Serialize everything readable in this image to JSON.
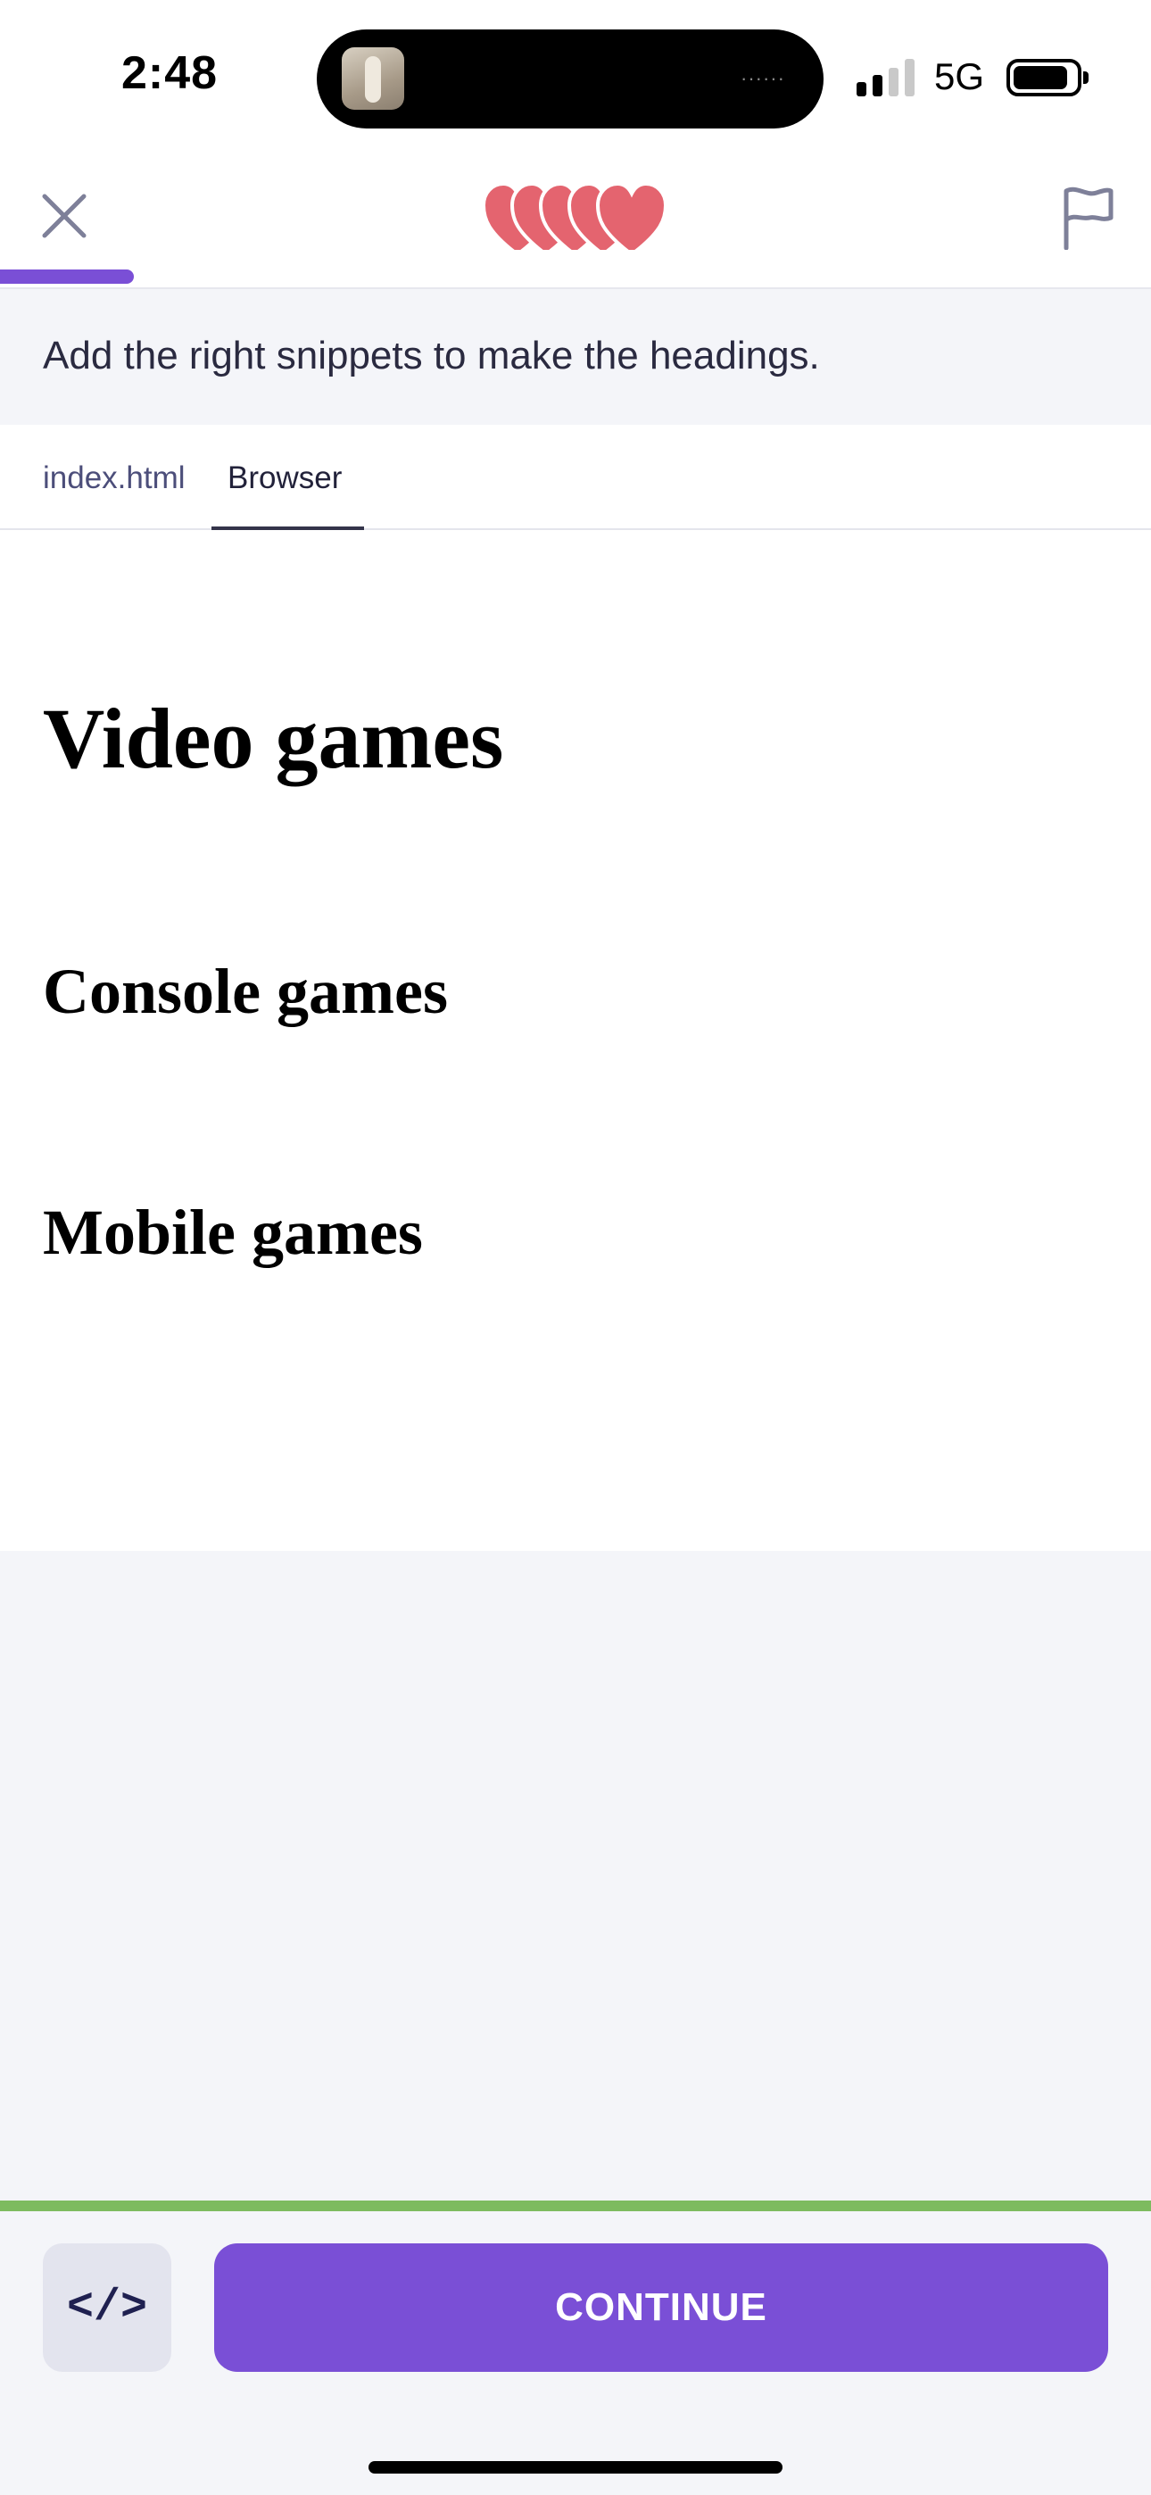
{
  "status_bar": {
    "time": "2:48",
    "network": "5G",
    "signal_bars_filled": 2,
    "signal_bars_total": 4,
    "island_dots": "······"
  },
  "header": {
    "close_icon": "close-icon",
    "hearts_count": 5,
    "heart_color": "#e4646f",
    "flag_icon": "flag-icon",
    "progress_fraction": 0.116,
    "progress_color": "#7a4fd6"
  },
  "instruction": {
    "text": "Add the right snippets to make the headings."
  },
  "tabs": [
    {
      "label": "index.html",
      "active": false
    },
    {
      "label": "Browser",
      "active": true
    }
  ],
  "browser": {
    "h1": "Video games",
    "h2_items": [
      "Console games",
      "Mobile games"
    ]
  },
  "bottom": {
    "code_label": "</>",
    "continue_label": "CONTINUE",
    "accent_color": "#7a4fd6",
    "success_line_color": "#7dbb5f"
  }
}
